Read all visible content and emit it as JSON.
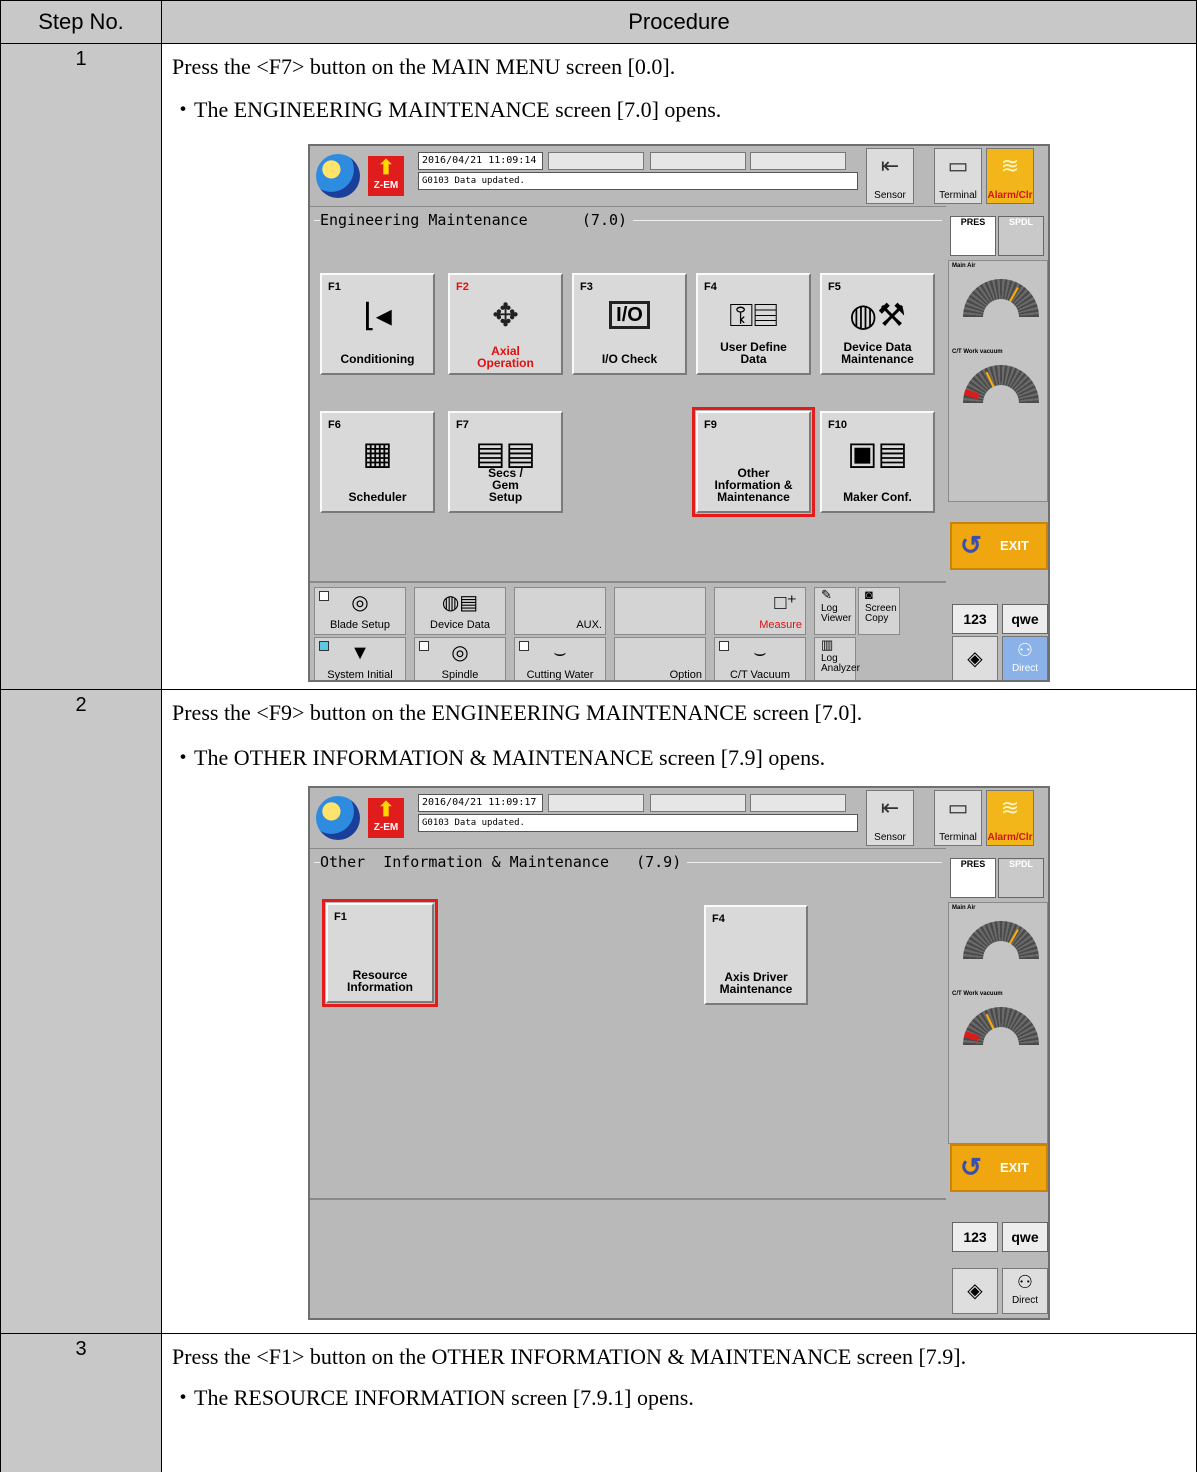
{
  "table": {
    "col_step": "Step No.",
    "col_procedure": "Procedure",
    "steps": [
      {
        "no": "1",
        "instruction": "Press the <F7> button on the MAIN MENU screen [0.0].",
        "result": "・The ENGINEERING MAINTENANCE screen [7.0] opens."
      },
      {
        "no": "2",
        "instruction": "Press the <F9> button on the ENGINEERING MAINTENANCE screen [7.0].",
        "result": "・The OTHER INFORMATION & MAINTENANCE screen [7.9] opens."
      },
      {
        "no": "3",
        "instruction": "Press the <F1> button on the OTHER INFORMATION & MAINTENANCE screen [7.9].",
        "result": "・The RESOURCE INFORMATION screen [7.9.1] opens."
      }
    ]
  },
  "common": {
    "zem_label": "Z-EM",
    "message": "G0103  Data updated.",
    "sensor": "Sensor",
    "terminal": "Terminal",
    "alarm": "Alarm/Clr",
    "pres": "PRES",
    "spdl": "SPDL",
    "gauge1": "Main Air",
    "gauge2": "C/T Work vacuum",
    "exit": "EXIT",
    "key_123": "123",
    "key_qwe": "qwe",
    "direct": "Direct"
  },
  "screen1": {
    "datetime": "2016/04/21 11:09:14",
    "title": "Engineering Maintenance      (7.0)",
    "buttons": [
      {
        "key": "F1",
        "label": "Conditioning",
        "icon": "conditioning-icon"
      },
      {
        "key": "F2",
        "label": "Axial Operation",
        "icon": "axial-operation-icon"
      },
      {
        "key": "F3",
        "label": "I/O Check",
        "icon": "io-check-icon"
      },
      {
        "key": "F4",
        "label": "User Define Data",
        "icon": "user-define-icon"
      },
      {
        "key": "F5",
        "label": "Device Data Maintenance",
        "icon": "device-data-icon"
      },
      {
        "key": "F6",
        "label": "Scheduler",
        "icon": "scheduler-icon"
      },
      {
        "key": "F7",
        "label": "Secs / Gem Setup",
        "icon": "secs-gem-icon"
      },
      {
        "key": "F9",
        "label": "Other Information & Maintenance",
        "icon": ""
      },
      {
        "key": "F10",
        "label": "Maker Conf.",
        "icon": "maker-only-icon"
      }
    ],
    "bottom_buttons": [
      "Blade Setup",
      "Device Data",
      "AUX.",
      "",
      "Measure",
      "Log Viewer",
      "Screen Copy",
      "System Initial",
      "Spindle",
      "Cutting Water",
      "Option",
      "C/T Vacuum",
      "Log Analyzer"
    ]
  },
  "screen2": {
    "datetime": "2016/04/21 11:09:17",
    "title": "Other  Information & Maintenance   (7.9)",
    "buttons": [
      {
        "key": "F1",
        "label": "Resource Information"
      },
      {
        "key": "F4",
        "label": "Axis Driver Maintenance"
      }
    ]
  },
  "colors": {
    "highlight": "#e31b1b",
    "screen_bg": "#b9b9b9",
    "header_bg": "#c8c8c8",
    "exit_bg": "#f0a60e"
  }
}
